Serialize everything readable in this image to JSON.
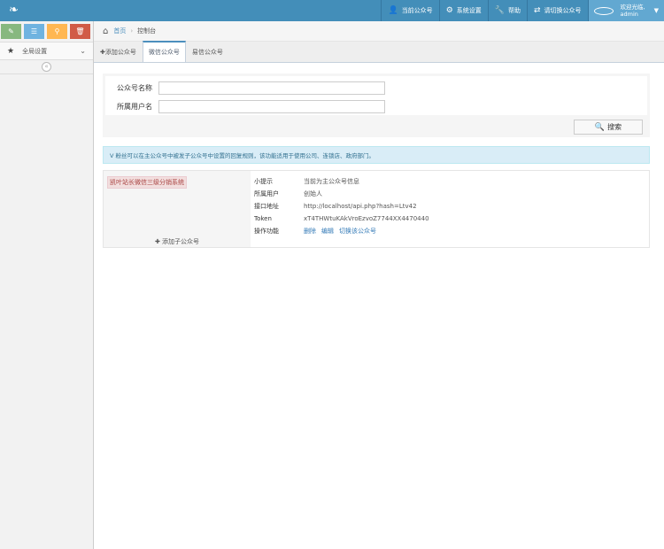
{
  "navbar": {
    "brand_icon": "leaf-icon",
    "items": [
      {
        "label": "当前公众号",
        "icon": "user-icon"
      },
      {
        "label": "系统设置",
        "icon": "gear-icon"
      },
      {
        "label": "帮助",
        "icon": "wrench-icon"
      },
      {
        "label": "请切换公众号",
        "icon": "exchange-icon"
      }
    ],
    "user": {
      "greeting": "欢迎光临,",
      "name": "admin"
    },
    "accent": "#438eb9"
  },
  "sidebar": {
    "shortcut_icons": [
      "pencil-icon",
      "list-icon",
      "search-icon",
      "trash-icon"
    ],
    "menu": [
      {
        "label": "全局设置",
        "icon": "star-icon"
      }
    ],
    "collapse_glyph": "«"
  },
  "breadcrumb": {
    "home": "首页",
    "current": "控制台"
  },
  "tabs": [
    {
      "label": "添加公众号",
      "prefix": "✚",
      "active": false
    },
    {
      "label": "微信公众号",
      "prefix": "",
      "active": true
    },
    {
      "label": "易信公众号",
      "prefix": "",
      "active": false
    }
  ],
  "search": {
    "fields": [
      {
        "label": "公众号名称",
        "value": ""
      },
      {
        "label": "所属用户名",
        "value": ""
      }
    ],
    "button": "搜索"
  },
  "alert": "V 粉丝可以在主公众号中被发子公众号中设置的回复规则，该功能适用于使用公司、连锁店、政府部门。",
  "account": {
    "name": "凯叶站长微信三级分销系统",
    "add_sub": "添加子公众号",
    "rows": [
      {
        "key": "小提示",
        "value": "当前为主公众号信息"
      },
      {
        "key": "所属用户",
        "value": "创始人"
      },
      {
        "key": "接口地址",
        "value": "http://localhost/api.php?hash=Ltv42"
      },
      {
        "key": "Token",
        "value": "xT4THWtuKAkVroEzvoZ7744XX4470440"
      }
    ],
    "ops_key": "操作功能",
    "ops": [
      "删除",
      "编辑",
      "切换该公众号"
    ]
  }
}
